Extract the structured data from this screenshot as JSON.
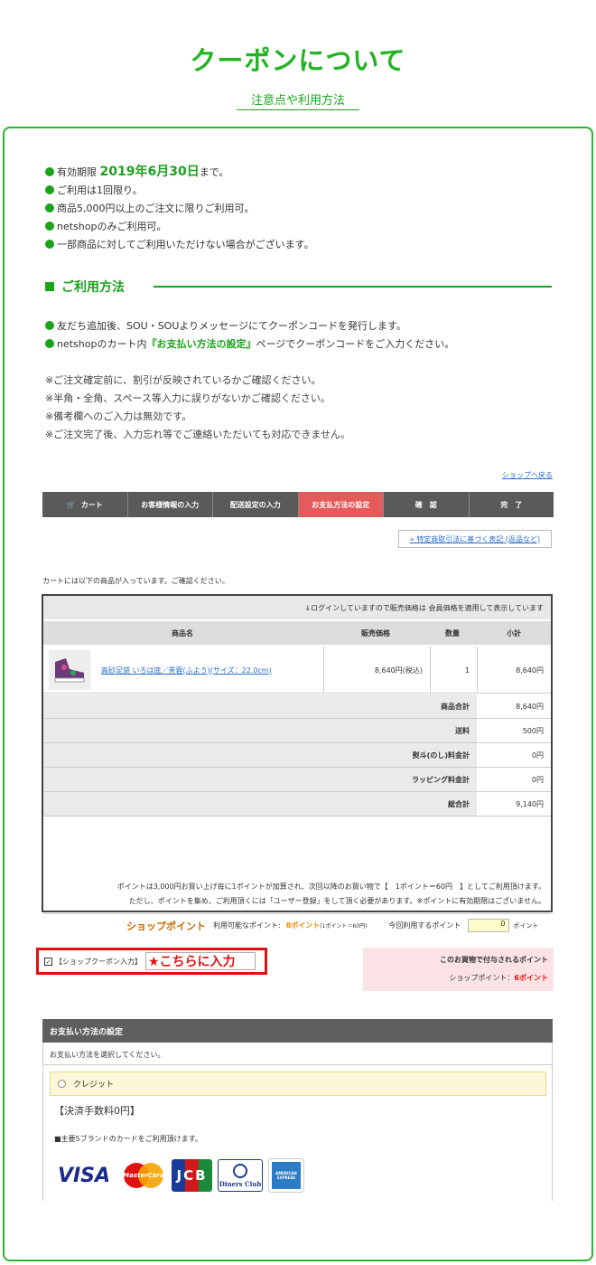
{
  "header": {
    "title": "クーポンについて",
    "subtitle": "注意点や利用方法"
  },
  "terms": {
    "validity_prefix": "有効期限 ",
    "validity_date": "2019年6月30日",
    "validity_suffix": "まで。",
    "items": [
      "ご利用は1回限り。",
      "商品5,000円以上のご注文に限りご利用可。",
      "netshopのみご利用可。",
      "一部商品に対してご利用いただけない場合がございます。"
    ]
  },
  "usage": {
    "heading": "ご利用方法",
    "step1": "友だち追加後、SOU・SOUよりメッセージにてクーポンコードを発行します。",
    "step2_prefix": "netshopのカート内",
    "step2_link": "『お支払い方法の設定』",
    "step2_suffix": "ページでクーポンコードをご入力ください。",
    "notes": [
      "※ご注文確定前に、割引が反映されているかご確認ください。",
      "※半角・全角、スペース等入力に誤りがないかご確認ください。",
      "※備考欄へのご入力は無効です。",
      "※ご注文完了後、入力忘れ等でご連絡いただいても対応できません。"
    ]
  },
  "cart": {
    "shop_back": "ショップへ戻る",
    "steps": [
      "カート",
      "お客様情報の入力",
      "配送設定の入力",
      "お支払方法の設定",
      "確　認",
      "完　了"
    ],
    "legal_link": "» 特定商取引法に基づく表記 (返品など)",
    "intro": "カートには以下の商品が入っています。ご確認ください。",
    "login_notice": "↓ログインしていますので販売価格は 会員価格を適用して表示しています",
    "headers": {
      "name": "商品名",
      "price": "販売価格",
      "qty": "数量",
      "subtotal": "小計"
    },
    "item": {
      "name": "高砂足袋 いろは底／芙蓉(ふよう)(サイズ：22.0cm)",
      "price": "8,640円(税込)",
      "qty": "1",
      "subtotal": "8,640円"
    },
    "summary": [
      {
        "label": "商品合計",
        "value": "8,640円"
      },
      {
        "label": "送料",
        "value": "500円"
      },
      {
        "label": "熨斗(のし)料金計",
        "value": "0円"
      },
      {
        "label": "ラッピング料金計",
        "value": "0円"
      },
      {
        "label": "総合計",
        "value": "9,140円"
      }
    ],
    "point_note1": "ポイントは3,000円お買い上げ毎に1ポイントが加算され、次回以降のお買い物で【　1ポイント＝60円　】としてご利用頂けます。",
    "point_note2": "ただし、ポイントを集め、ご利用頂くには「ユーザー登録」をして頂く必要があります。※ポイントに有効期限はございません。",
    "shop_point": "ショップポイント",
    "available_label": "利用可能なポイント:",
    "available_value": "8ポイント",
    "available_rate": "(1ポイント＝60円)",
    "use_label": "今回利用するポイント",
    "use_value": "0",
    "use_unit": "ポイント"
  },
  "coupon": {
    "check": "✓",
    "label": "【ショップクーポン入力】",
    "input_hint": "★こちらに入力"
  },
  "gain": {
    "title": "このお買物で付与されるポイント",
    "label": "ショップポイント：",
    "value": "6ポイント"
  },
  "payment": {
    "heading": "お支払い方法の設定",
    "instruction": "お支払い方法を選択してください。",
    "option": "クレジット",
    "fee": "【決済手数料0円】",
    "brands_note": "■主要5ブランドのカードをご利用頂けます。",
    "cards": [
      "VISA",
      "MasterCard",
      "JCB",
      "Diners Club",
      "AMERICAN EXPRESS"
    ]
  },
  "colors": {
    "accent": "#1aa31a",
    "active_step": "#e55a5a",
    "coupon_border": "#e01010"
  }
}
